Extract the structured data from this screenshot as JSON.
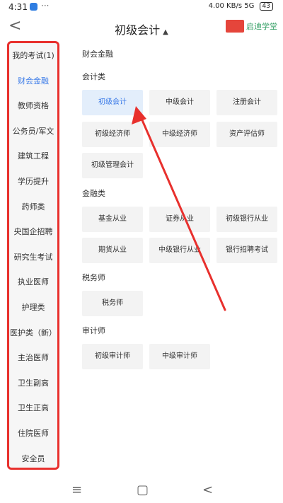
{
  "status": {
    "time": "4:31",
    "more": "···",
    "net_speed": "4.00 KB/s",
    "signal": "5G",
    "battery": "43"
  },
  "header": {
    "back": "<",
    "title": "初级会计",
    "caret": "▲",
    "logo_text": "启迪学堂"
  },
  "sidebar": {
    "items": [
      {
        "label": "我的考试(1)"
      },
      {
        "label": "财会金融"
      },
      {
        "label": "教师资格"
      },
      {
        "label": "公务员/军文"
      },
      {
        "label": "建筑工程"
      },
      {
        "label": "学历提升"
      },
      {
        "label": "药师类"
      },
      {
        "label": "央国企招聘"
      },
      {
        "label": "研究生考试"
      },
      {
        "label": "执业医师"
      },
      {
        "label": "护理类"
      },
      {
        "label": "医护类（新）"
      },
      {
        "label": "主治医师"
      },
      {
        "label": "卫生副高"
      },
      {
        "label": "卫生正高"
      },
      {
        "label": "住院医师"
      },
      {
        "label": "安全员"
      }
    ]
  },
  "content": {
    "heading": "财会金融",
    "sections": [
      {
        "title": "会计类",
        "items": [
          "初级会计",
          "中级会计",
          "注册会计",
          "初级经济师",
          "中级经济师",
          "资产评估师",
          "初级管理会计"
        ]
      },
      {
        "title": "金融类",
        "items": [
          "基金从业",
          "证券从业",
          "初级银行从业",
          "期货从业",
          "中级银行从业",
          "银行招聘考试"
        ]
      },
      {
        "title": "税务师",
        "items": [
          "税务师"
        ]
      },
      {
        "title": "审计师",
        "items": [
          "初级审计师",
          "中级审计师"
        ]
      }
    ]
  },
  "navbar": {
    "menu": "≡",
    "home": "▢",
    "back": "<"
  },
  "colors": {
    "accent": "#3b7be8",
    "highlight": "#e8302d"
  }
}
